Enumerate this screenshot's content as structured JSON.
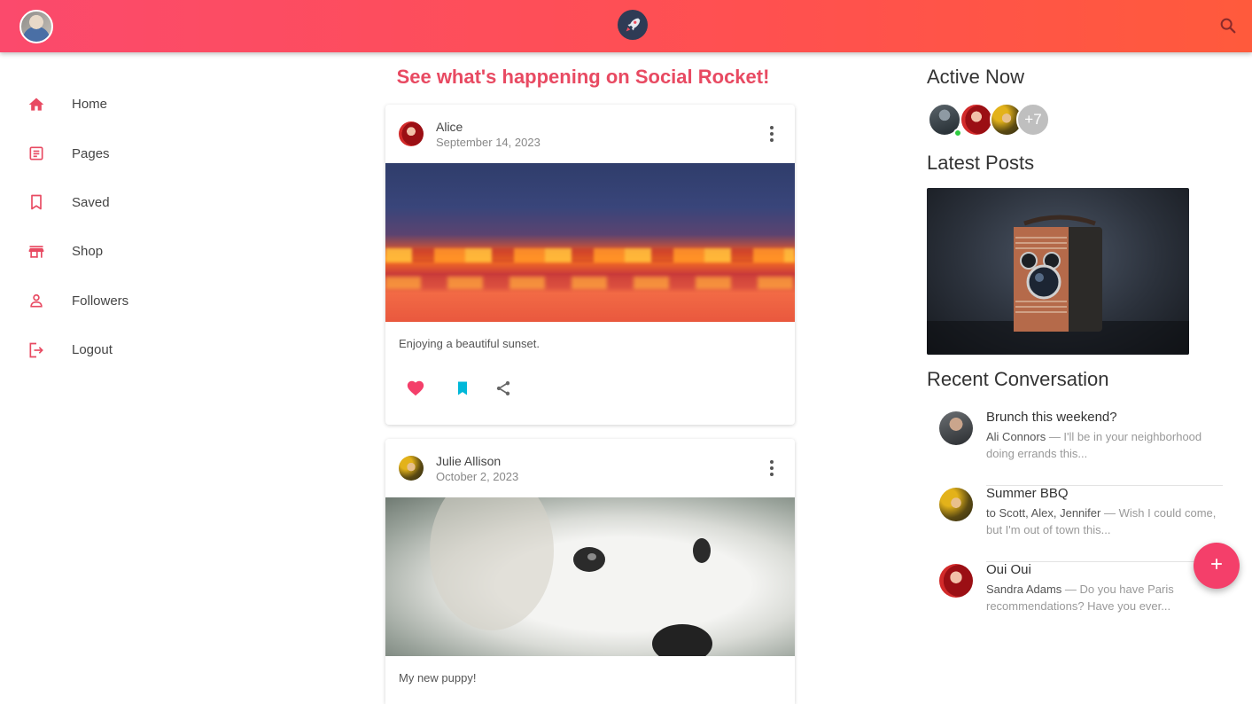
{
  "app": {
    "name": "Social Rocket"
  },
  "colors": {
    "accent": "#f43f6a",
    "heading": "#e84a62",
    "bookmark": "#00b8d9",
    "online": "#2ecc40"
  },
  "sidebar": {
    "items": [
      {
        "label": "Home",
        "icon": "home-icon"
      },
      {
        "label": "Pages",
        "icon": "article-icon"
      },
      {
        "label": "Saved",
        "icon": "bookmark-icon"
      },
      {
        "label": "Shop",
        "icon": "store-icon"
      },
      {
        "label": "Followers",
        "icon": "person-icon"
      },
      {
        "label": "Logout",
        "icon": "logout-icon"
      }
    ]
  },
  "feed": {
    "title": "See what's happening on Social Rocket!",
    "posts": [
      {
        "author": "Alice",
        "date": "September 14, 2023",
        "text": "Enjoying a beautiful sunset.",
        "image": "sunset-photo"
      },
      {
        "author": "Julie Allison",
        "date": "October 2, 2023",
        "text": "My new puppy!",
        "image": "puppy-photo"
      }
    ]
  },
  "right": {
    "active_title": "Active Now",
    "active_more": "+7",
    "latest_title": "Latest Posts",
    "latest_image": "camera-photo",
    "recent_title": "Recent Conversation",
    "conversations": [
      {
        "title": "Brunch this weekend?",
        "sender": "Ali Connors",
        "preview": " — I'll be in your neighborhood doing errands this..."
      },
      {
        "title": "Summer BBQ",
        "sender": "to Scott, Alex, Jennifer",
        "preview": " — Wish I could come, but I'm out of town this..."
      },
      {
        "title": "Oui Oui",
        "sender": "Sandra Adams",
        "preview": " — Do you have Paris recommendations? Have you ever..."
      }
    ]
  },
  "fab": {
    "icon": "plus-icon"
  }
}
